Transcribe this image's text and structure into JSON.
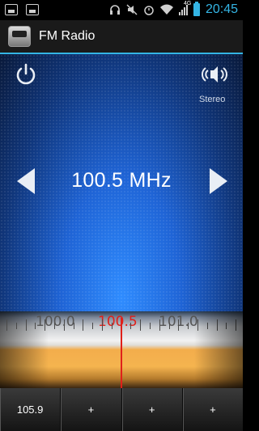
{
  "status_bar": {
    "time": "20:45",
    "signal_note": "4G",
    "left_icons": [
      "gallery-icon",
      "image-icon"
    ],
    "right_icons": [
      "headphones-icon",
      "mute-icon",
      "alarm-icon",
      "wifi-icon",
      "signal-icon",
      "battery-icon"
    ]
  },
  "app": {
    "title": "FM Radio",
    "icon": "radio-app-icon"
  },
  "controls": {
    "power_icon": "power-icon",
    "speaker_icon": "speaker-icon",
    "audio_mode": "Stereo",
    "prev_icon": "left-arrow-icon",
    "next_icon": "right-arrow-icon"
  },
  "tuner": {
    "frequency": "100.5 MHz",
    "dial_labels": [
      "100.0",
      "100.5",
      "101.0"
    ],
    "active_label": "100.5",
    "active_color": "#e0201a"
  },
  "presets": [
    "105.9",
    "+",
    "+",
    "+"
  ],
  "colors": {
    "accent": "#34b5e5",
    "needle": "#e0201a"
  }
}
